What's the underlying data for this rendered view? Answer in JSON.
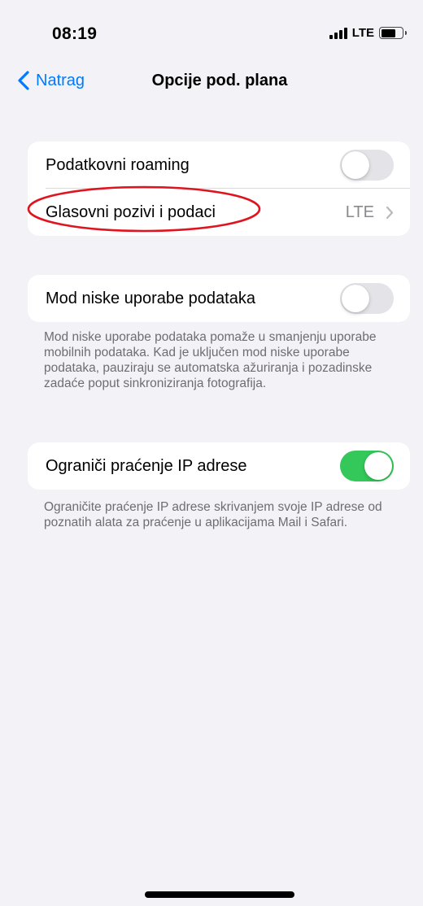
{
  "status_bar": {
    "time": "08:19",
    "network": "LTE",
    "signal_icon": "signal-bars-icon",
    "battery_icon": "battery-icon"
  },
  "nav": {
    "back_label": "Natrag",
    "title": "Opcije pod. plana"
  },
  "group1": {
    "roaming_label": "Podatkovni roaming",
    "roaming_on": false,
    "voice_label": "Glasovni pozivi i podaci",
    "voice_value": "LTE"
  },
  "group2": {
    "low_data_label": "Mod niske uporabe podataka",
    "low_data_on": false,
    "footnote": "Mod niske uporabe podataka pomaže u smanjenju uporabe mobilnih podataka. Kad je uključen mod niske uporabe podataka, pauziraju se automatska ažuriranja i pozadinske zadaće poput sinkroniziranja fotografija."
  },
  "group3": {
    "ip_label": "Ograniči praćenje IP adrese",
    "ip_on": true,
    "footnote": "Ograničite praćenje IP adrese skrivanjem svoje IP adrese od poznatih alata za praćenje u aplikacijama Mail i Safari."
  },
  "colors": {
    "accent": "#007aff",
    "toggle_on": "#34c759",
    "annotation": "#e0141e"
  }
}
